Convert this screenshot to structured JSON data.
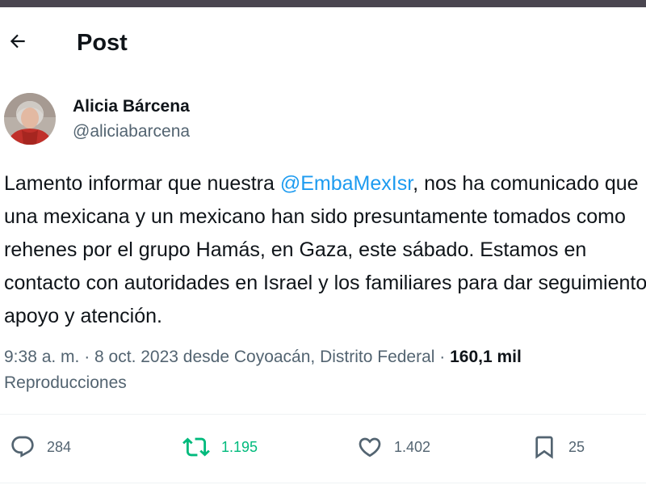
{
  "header": {
    "title": "Post",
    "back_icon": "arrow-left-icon"
  },
  "author": {
    "display_name": "Alicia Bárcena",
    "handle": "@aliciabarcena"
  },
  "tweet": {
    "line1_before": "Lamento informar que nuestra ",
    "line1_mention": "@EmbaMexIsr",
    "line1_after": ", nos ha comunicado que",
    "line2": "una mexicana y un mexicano han sido presuntamente tomados como",
    "line3": "rehenes por el grupo Hamás, en Gaza, este sábado. Estamos en",
    "line4": "contacto con autoridades en Israel y los familiares para dar seguimiento,",
    "line5": "apoyo y atención."
  },
  "meta": {
    "timestamp": "9:38 a. m. · 8 oct. 2023 desde Coyoacán, Distrito Federal · ",
    "views_count": "160,1 mil",
    "views_label": "Reproducciones"
  },
  "actions": {
    "replies": "284",
    "retweets": "1.195",
    "likes": "1.402",
    "bookmarks": "25"
  },
  "colors": {
    "accent": "#1d9bf0",
    "retweet": "#00ba7c",
    "secondary_text": "#536471",
    "primary_text": "#0f1419"
  }
}
